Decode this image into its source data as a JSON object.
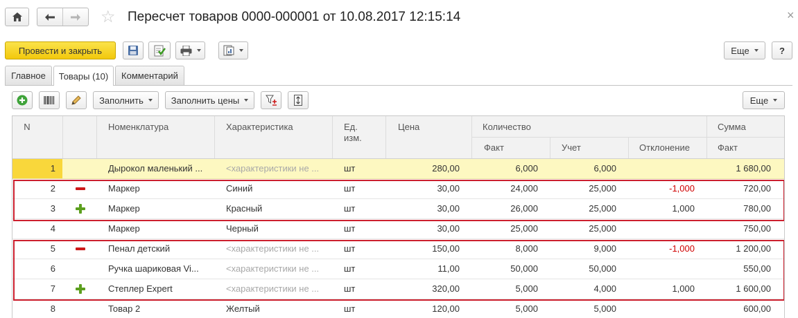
{
  "window": {
    "title": "Пересчет товаров 0000-000001 от 10.08.2017 12:15:14",
    "close_glyph": "×"
  },
  "commandbar": {
    "post_and_close": "Провести и закрыть",
    "more": "Еще",
    "help": "?"
  },
  "tabs": [
    {
      "label": "Главное"
    },
    {
      "label": "Товары (10)"
    },
    {
      "label": "Комментарий"
    }
  ],
  "table_toolbar": {
    "fill": "Заполнить",
    "fill_prices": "Заполнить цены",
    "more": "Еще"
  },
  "columns": {
    "n": "N",
    "nomenclature": "Номенклатура",
    "characteristic": "Характеристика",
    "unit": "Ед.\nизм.",
    "price": "Цена",
    "quantity": "Количество",
    "qty_fact": "Факт",
    "qty_account": "Учет",
    "qty_deviation": "Отклонение",
    "sum": "Сумма",
    "sum_fact": "Факт"
  },
  "rows": [
    {
      "n": "1",
      "mark": "",
      "name": "Дырокол маленький ...",
      "char": "<характеристики не ...",
      "unit": "шт",
      "price": "280,00",
      "fact": "6,000",
      "account": "6,000",
      "deviation": "",
      "sum": "1 680,00"
    },
    {
      "n": "2",
      "mark": "minus",
      "name": "Маркер",
      "char": "Синий",
      "unit": "шт",
      "price": "30,00",
      "fact": "24,000",
      "account": "25,000",
      "deviation": "-1,000",
      "sum": "720,00"
    },
    {
      "n": "3",
      "mark": "plus",
      "name": "Маркер",
      "char": "Красный",
      "unit": "шт",
      "price": "30,00",
      "fact": "26,000",
      "account": "25,000",
      "deviation": "1,000",
      "sum": "780,00"
    },
    {
      "n": "4",
      "mark": "",
      "name": "Маркер",
      "char": "Черный",
      "unit": "шт",
      "price": "30,00",
      "fact": "25,000",
      "account": "25,000",
      "deviation": "",
      "sum": "750,00"
    },
    {
      "n": "5",
      "mark": "minus",
      "name": "Пенал детский",
      "char": "<характеристики не ...",
      "unit": "шт",
      "price": "150,00",
      "fact": "8,000",
      "account": "9,000",
      "deviation": "-1,000",
      "sum": "1 200,00"
    },
    {
      "n": "6",
      "mark": "",
      "name": "Ручка шариковая Vi...",
      "char": "<характеристики не ...",
      "unit": "шт",
      "price": "11,00",
      "fact": "50,000",
      "account": "50,000",
      "deviation": "",
      "sum": "550,00"
    },
    {
      "n": "7",
      "mark": "plus",
      "name": "Степлер Expert",
      "char": "<характеристики не ...",
      "unit": "шт",
      "price": "320,00",
      "fact": "5,000",
      "account": "4,000",
      "deviation": "1,000",
      "sum": "1 600,00"
    },
    {
      "n": "8",
      "mark": "",
      "name": "Товар 2",
      "char": "Желтый",
      "unit": "шт",
      "price": "120,00",
      "fact": "5,000",
      "account": "5,000",
      "deviation": "",
      "sum": "600,00"
    }
  ],
  "colors": {
    "primary_button": "#f5d31f",
    "current_row": "#fdf8c1",
    "highlight_box": "#cc1f2e",
    "negative": "#d00000",
    "minus_mark": "#cc1a1a",
    "plus_mark": "#5c9f1e"
  }
}
